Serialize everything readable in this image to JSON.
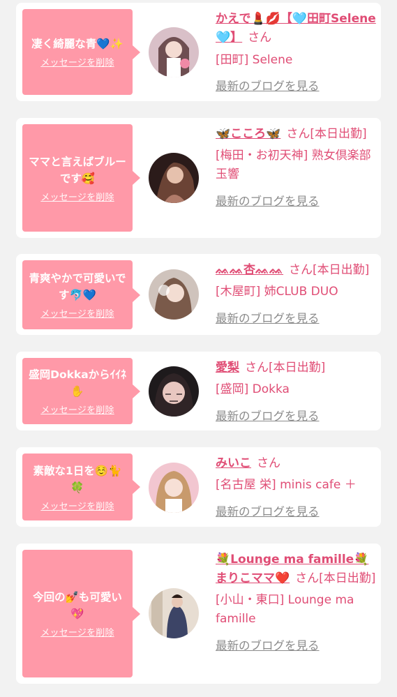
{
  "cards": [
    {
      "message": "凄く綺麗な青💙✨",
      "delete_label": "メッセージを削除",
      "name": "かえで💄💋【🩵田町Selene🩵】",
      "honorific": "さん",
      "shop": "[田町] Selene",
      "blog_link": "最新のブログを見る"
    },
    {
      "message": "ママと言えばブルーです🥰",
      "delete_label": "メッセージを削除",
      "name": "🦋こころ🦋",
      "honorific": "さん[本日出勤]",
      "shop": "[梅田・お初天神] 熟女倶楽部 玉響",
      "blog_link": "最新のブログを見る"
    },
    {
      "message": "青爽やかで可愛いです🐬💙",
      "delete_label": "メッセージを削除",
      "name": "ᨐᨐ杏ᨐᨐ",
      "honorific": "さん[本日出勤]",
      "shop": "[木屋町] 姉CLUB DUO",
      "blog_link": "最新のブログを見る"
    },
    {
      "message": "盛岡Dokkaからｲｲﾈ✋",
      "delete_label": "メッセージを削除",
      "name": "愛梨",
      "honorific": "さん[本日出勤]",
      "shop": "[盛岡] Dokka",
      "blog_link": "最新のブログを見る"
    },
    {
      "message": "素敵な1日を☺️🐈🍀",
      "delete_label": "メッセージを削除",
      "name": "みいこ",
      "honorific": "さん",
      "shop": "[名古屋 栄] minis cafe ＋",
      "blog_link": "最新のブログを見る"
    },
    {
      "message": "今回の💅も可愛い💖",
      "delete_label": "メッセージを削除",
      "name": "💐Lounge ma famille💐まりこママ❤️",
      "honorific": "さん[本日出勤]",
      "shop": "[小山・東口] Lounge ma famille",
      "blog_link": "最新のブログを見る"
    }
  ]
}
